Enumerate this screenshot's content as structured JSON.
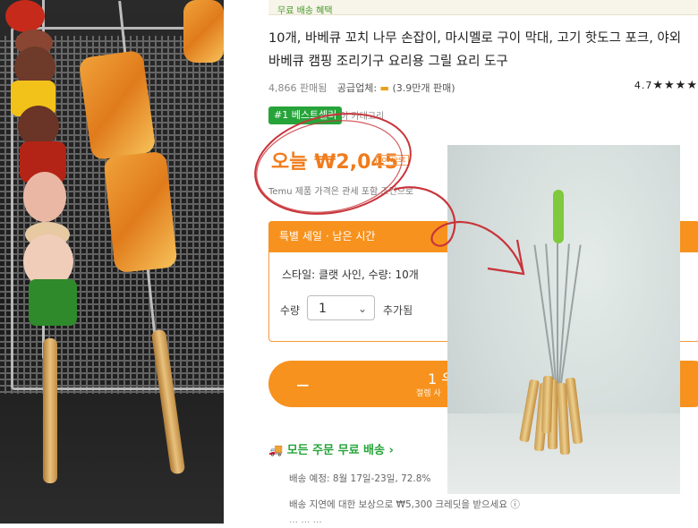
{
  "top_notice": "무료 배송 혜택",
  "product": {
    "title_line1": "10개, 바베큐 꼬치 나무 손잡이, 마시멜로 구이 막대, 고기 핫도그 포크, 야외",
    "title_line2": "바베큐 캠핑 조리기구 요리용 그릴 요리 도구",
    "sold_count": "4,866 판매됨",
    "supplier_label": "공급업체:",
    "supplier_rating": "(3.9만개 판매)",
    "rating_value": "4.7",
    "rating_stars": "★★★★",
    "badge_text": "#1 베스트셀러",
    "badge_tail": "이 카테고리"
  },
  "price": {
    "today_label": "오늘",
    "amount": "₩2,045",
    "tag": "lowest",
    "fine_print": "Temu 제품 가격은 관세 포함 조건으로"
  },
  "options": {
    "header": "특별 세일 · 남은 시간",
    "style_line": "스타일: 클랫 사인, 수량: 10개",
    "qty_label": "수량",
    "qty_value": "1",
    "add_label": "추가됨"
  },
  "buy_button": {
    "minus": "−",
    "label": "1 우",
    "sub": "절렘 사"
  },
  "shipping": {
    "headline": "모든 주문 무료 배송 ›",
    "date_line": "배송 예정: 8월 17일-23일, 72.8%",
    "delay_note": "배송 지연에 대한 보상으로 ₩5,300 크레딧을 받으세요 ⓘ",
    "more": "··· ··· ···"
  },
  "colors": {
    "accent_orange": "#f7921e",
    "price_orange": "#f07c1c",
    "green": "#26a43a",
    "annotation_red": "#c8343a"
  }
}
